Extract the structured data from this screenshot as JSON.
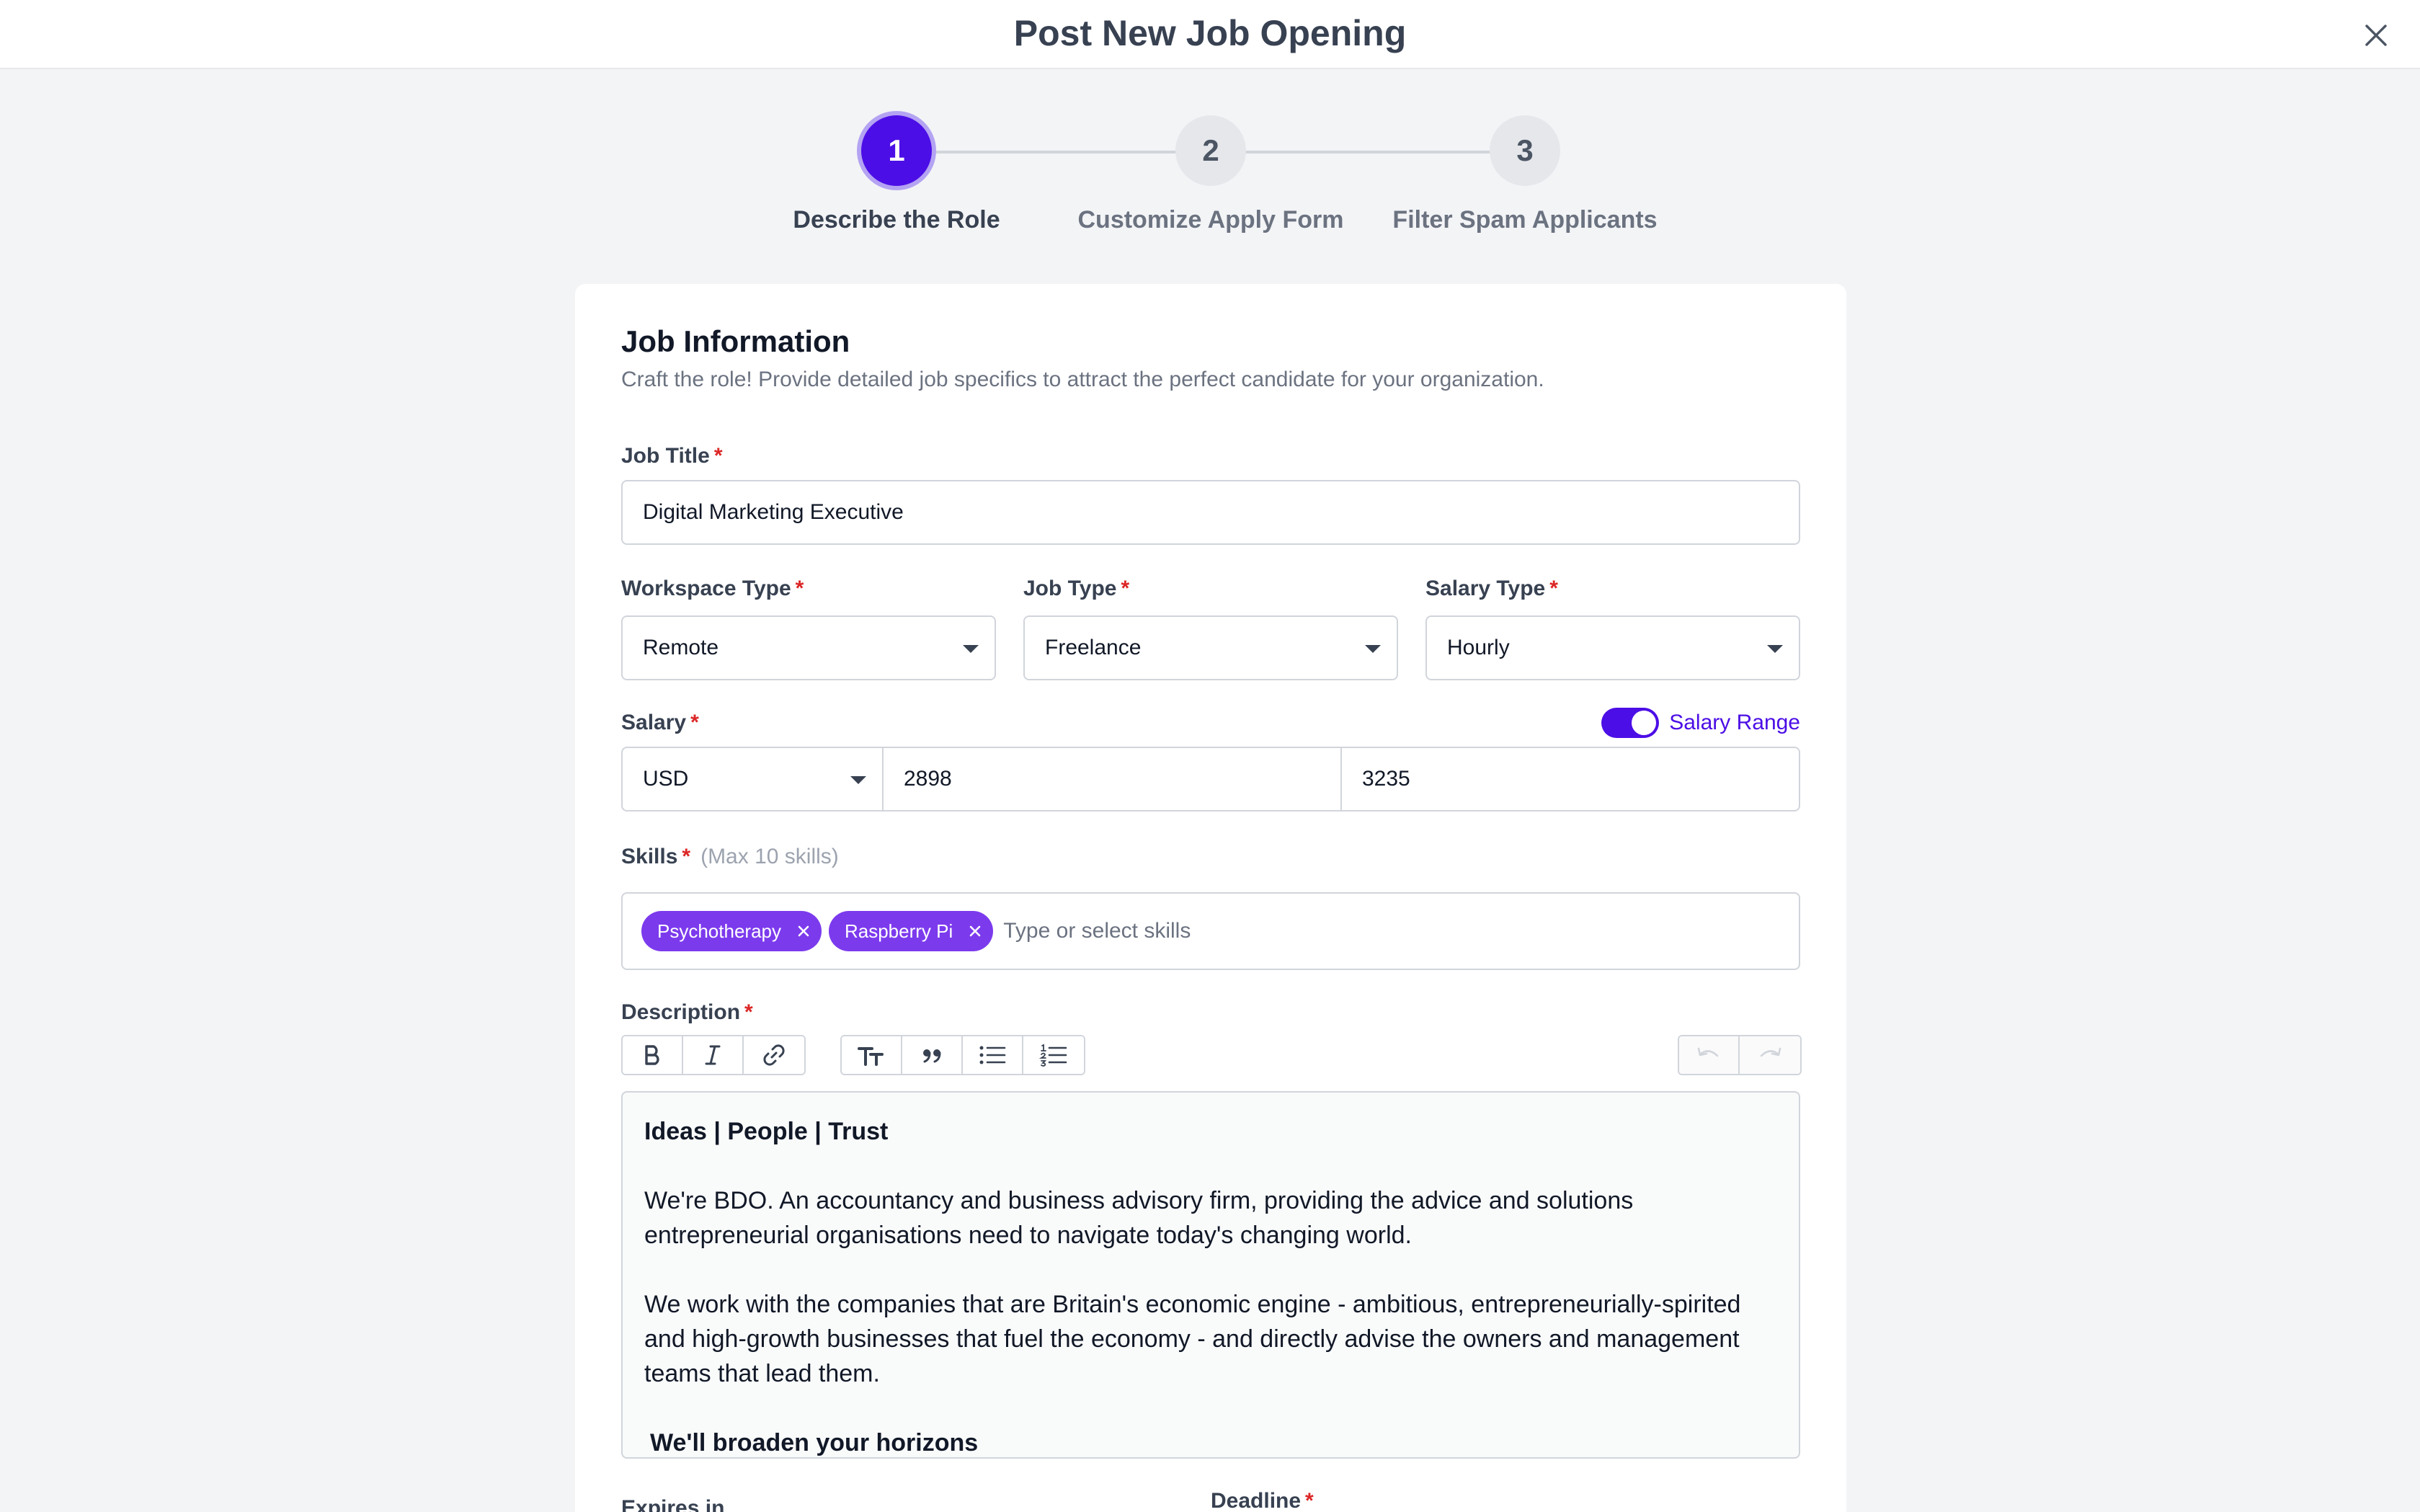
{
  "header": {
    "title": "Post New Job Opening"
  },
  "stepper": {
    "steps": [
      {
        "number": "1",
        "label": "Describe the Role"
      },
      {
        "number": "2",
        "label": "Customize Apply Form"
      },
      {
        "number": "3",
        "label": "Filter Spam Applicants"
      }
    ],
    "active_step": 1
  },
  "form": {
    "section_title": "Job Information",
    "section_subtitle": "Craft the role! Provide detailed job specifics to attract the perfect candidate for your organization.",
    "required_mark": "*",
    "job_title": {
      "label": "Job Title",
      "value": "Digital Marketing Executive"
    },
    "workspace_type": {
      "label": "Workspace Type",
      "value": "Remote"
    },
    "job_type": {
      "label": "Job Type",
      "value": "Freelance"
    },
    "salary_type": {
      "label": "Salary Type",
      "value": "Hourly"
    },
    "salary": {
      "label": "Salary",
      "currency": "USD",
      "min": "2898",
      "max": "3235",
      "range_toggle_label": "Salary Range",
      "range_enabled": true
    },
    "skills": {
      "label": "Skills",
      "hint": "(Max 10 skills)",
      "chips": [
        "Psychotherapy",
        "Raspberry Pi"
      ],
      "placeholder": "Type or select skills"
    },
    "description": {
      "label": "Description",
      "heading": "Ideas | People | Trust",
      "paragraph1": "We're BDO. An accountancy and business advisory firm, providing the advice and solutions entrepreneurial organisations need to navigate today's changing world.",
      "paragraph2": "We work with the companies that are Britain's economic engine - ambitious, entrepreneurially-spirited and high-growth businesses that fuel the economy - and directly advise the owners and management teams that lead them.",
      "subheading": "We'll broaden your horizons"
    },
    "expires_in": {
      "label": "Expires in"
    },
    "deadline": {
      "label": "Deadline"
    }
  },
  "colors": {
    "accent": "#4c0ee6",
    "chip": "#7c3aed",
    "required": "#dc2626"
  },
  "icons": {
    "close": "close-icon",
    "bold": "bold-icon",
    "italic": "italic-icon",
    "link": "link-icon",
    "heading": "text-size-icon",
    "quote": "quote-icon",
    "bullet_list": "bullet-list-icon",
    "numbered_list": "numbered-list-icon",
    "undo": "undo-icon",
    "redo": "redo-icon"
  }
}
